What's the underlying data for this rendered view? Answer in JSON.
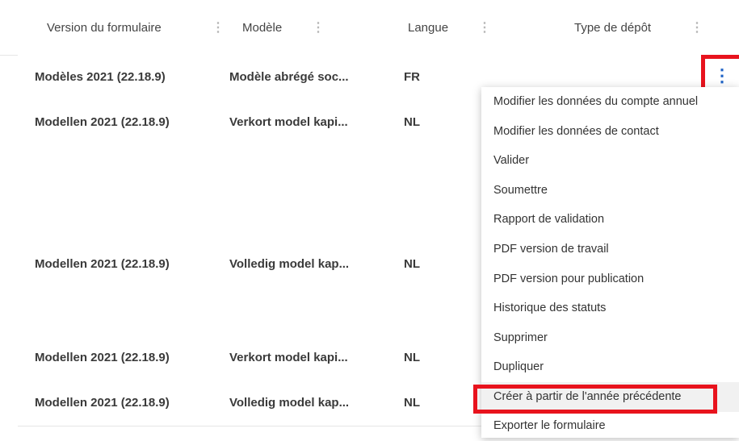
{
  "columns": [
    {
      "label": "Version du formulaire"
    },
    {
      "label": "Modèle"
    },
    {
      "label": "Langue"
    },
    {
      "label": "Type de dépôt"
    }
  ],
  "rows": [
    {
      "version": "Modèles 2021 (22.18.9)",
      "model": "Modèle abrégé soc...",
      "lang": "FR"
    },
    {
      "version": "Modellen 2021 (22.18.9)",
      "model": "Verkort model kapi...",
      "lang": "NL"
    },
    {
      "version": "",
      "model": "",
      "lang": ""
    },
    {
      "version": "",
      "model": "",
      "lang": ""
    },
    {
      "version": "Modellen 2021 (22.18.9)",
      "model": "Volledig model kap...",
      "lang": "NL"
    },
    {
      "version": "",
      "model": "",
      "lang": ""
    },
    {
      "version": "Modellen 2021 (22.18.9)",
      "model": "Verkort model kapi...",
      "lang": "NL"
    },
    {
      "version": "Modellen 2021 (22.18.9)",
      "model": "Volledig model kap...",
      "lang": "NL"
    }
  ],
  "row_actions_icon": "⋮",
  "column_menu_icon": "⋮",
  "context_menu": [
    "Modifier les données du compte annuel",
    "Modifier les données de contact",
    "Valider",
    "Soumettre",
    "Rapport de validation",
    "PDF version de travail",
    "PDF version pour publication",
    "Historique des statuts",
    "Supprimer",
    "Dupliquer",
    "Créer à partir de l'année précédente",
    "Exporter le formulaire"
  ],
  "colors": {
    "highlight": "#e8131d",
    "accent": "#1f63c6"
  }
}
